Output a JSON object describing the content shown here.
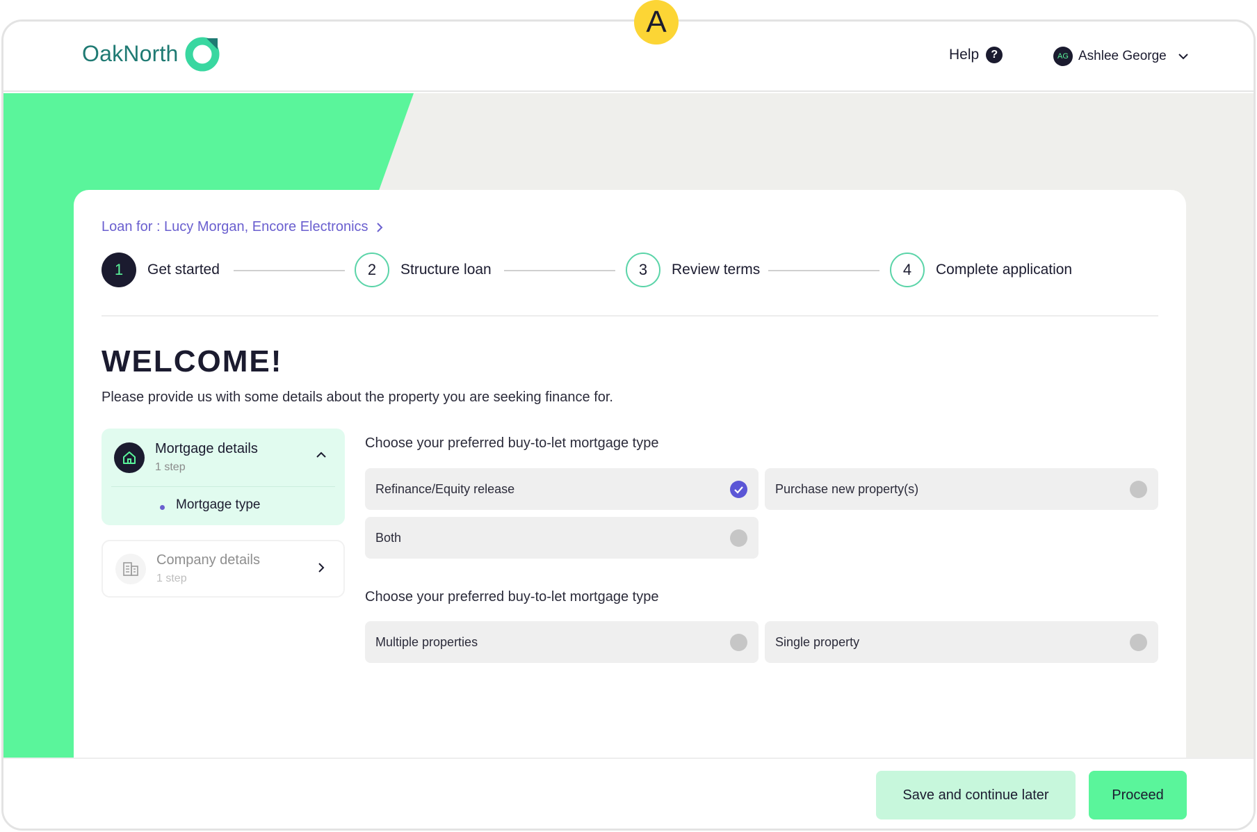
{
  "marker": {
    "label": "A"
  },
  "header": {
    "logo_text": "OakNorth",
    "help_label": "Help",
    "help_badge": "?",
    "user": {
      "initials": "AG",
      "name": "Ashlee George"
    }
  },
  "breadcrumb": {
    "label": "Loan for : Lucy Morgan, Encore Electronics"
  },
  "stepper": {
    "steps": [
      {
        "number": "1",
        "label": "Get started",
        "state": "active"
      },
      {
        "number": "2",
        "label": "Structure loan",
        "state": "pending"
      },
      {
        "number": "3",
        "label": "Review terms",
        "state": "pending"
      },
      {
        "number": "4",
        "label": "Complete application",
        "state": "pending"
      }
    ]
  },
  "welcome": {
    "title": "WELCOME!",
    "subtitle": "Please provide us with some details about the property you are seeking finance for."
  },
  "sections": {
    "mortgage": {
      "title": "Mortgage details",
      "sub": "1 step",
      "item": "Mortgage type",
      "expanded": true,
      "icon": "home-icon"
    },
    "company": {
      "title": "Company details",
      "sub": "1 step",
      "expanded": false,
      "icon": "building-icon"
    }
  },
  "questions": {
    "q1": {
      "label": "Choose your preferred buy-to-let mortgage type",
      "options": [
        {
          "label": "Refinance/Equity release",
          "selected": true
        },
        {
          "label": "Purchase new property(s)",
          "selected": false
        },
        {
          "label": "Both",
          "selected": false
        }
      ]
    },
    "q2": {
      "label": "Choose your preferred buy-to-let mortgage type",
      "options": [
        {
          "label": "Multiple properties",
          "selected": false
        },
        {
          "label": "Single property",
          "selected": false
        }
      ]
    }
  },
  "footer": {
    "save_label": "Save and continue later",
    "proceed_label": "Proceed"
  },
  "colors": {
    "accent_green": "#5af59b",
    "dark_navy": "#1b1b2f",
    "link_purple": "#6a5fcf",
    "teal_logo": "#1f7a73",
    "selected_radio": "#5b56d6"
  }
}
